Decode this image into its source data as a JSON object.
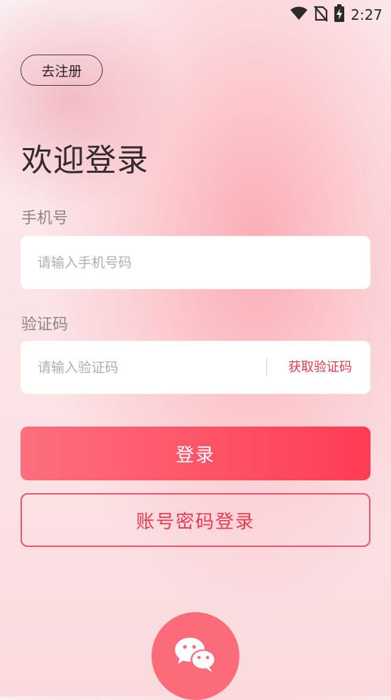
{
  "status_bar": {
    "time": "2:27",
    "icons": [
      "wifi-icon",
      "no-sim-icon",
      "battery-charging-icon"
    ]
  },
  "header": {
    "register_label": "去注册",
    "title": "欢迎登录"
  },
  "form": {
    "phone": {
      "label": "手机号",
      "placeholder": "请输入手机号码",
      "value": ""
    },
    "code": {
      "label": "验证码",
      "placeholder": "请输入验证码",
      "value": "",
      "get_code_label": "获取验证码"
    }
  },
  "actions": {
    "login_label": "登录",
    "password_login_label": "账号密码登录",
    "wechat_icon": "wechat-icon"
  },
  "colors": {
    "accent": "#ff3c54",
    "accent_light": "#fd6f7e",
    "wechat_button": "#fb6b7a"
  }
}
